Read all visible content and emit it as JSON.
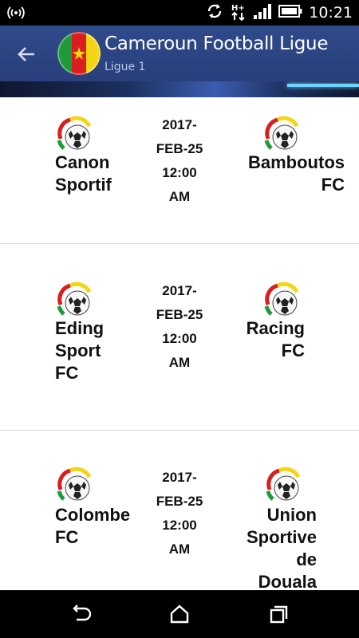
{
  "status_bar": {
    "time": "10:21",
    "icons": [
      "wifi-hotspot-icon",
      "sync-icon",
      "data-transfer-icon",
      "signal-icon",
      "battery-icon"
    ]
  },
  "app_bar": {
    "title": "Cameroun Football Ligue",
    "subtitle": "Ligue 1",
    "back_icon": "arrow-left-icon",
    "logo_icon": "cameroon-flag-ball-icon"
  },
  "matches": [
    {
      "home": [
        "Canon",
        "Sportif"
      ],
      "date": "2017-\nFEB-25\n12:00\nAM",
      "away": [
        "Bamboutos",
        "FC"
      ]
    },
    {
      "home": [
        "Eding",
        "Sport",
        "FC"
      ],
      "date": "2017-\nFEB-25\n12:00\nAM",
      "away": [
        "Racing",
        "FC"
      ]
    },
    {
      "home": [
        "Colombe",
        "FC"
      ],
      "date": "2017-\nFEB-25\n12:00\nAM",
      "away": [
        "Union",
        "Sportive",
        "de",
        "Douala"
      ]
    }
  ],
  "nav_bar": {
    "icons": [
      "back-nav-icon",
      "home-nav-icon",
      "recent-apps-icon"
    ]
  },
  "colors": {
    "app_bar": "#2f4a8a",
    "status_bar": "#000000",
    "divider": "#d9d9d9"
  }
}
